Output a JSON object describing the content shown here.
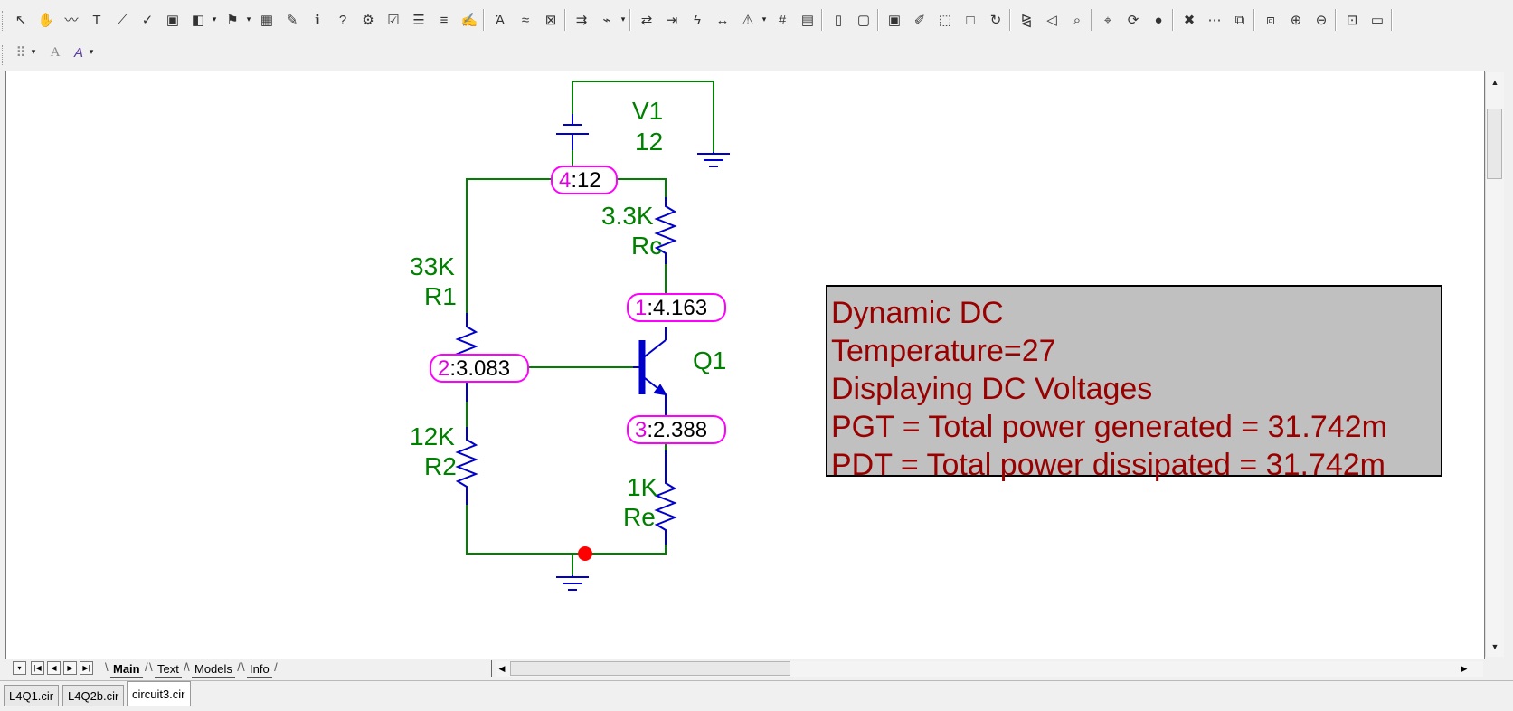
{
  "toolbar_main": {
    "buttons": [
      {
        "name": "select-mode-icon",
        "glyph": "↖"
      },
      {
        "name": "pan-mode-icon",
        "glyph": "✋"
      },
      {
        "name": "wire-mode-icon",
        "glyph": "〰"
      },
      {
        "name": "text-mode-icon",
        "glyph": "T"
      },
      {
        "name": "wire-draw-icon",
        "glyph": "⟋"
      },
      {
        "name": "diagonal-wire-icon",
        "glyph": "✓"
      },
      {
        "name": "component-icon",
        "glyph": "▣"
      },
      {
        "name": "shapes-icon",
        "glyph": "◧"
      },
      {
        "name": "flag-icon",
        "glyph": "⚑"
      },
      {
        "name": "grid-table-icon",
        "glyph": "▦"
      },
      {
        "name": "tool-icon",
        "glyph": "✎"
      },
      {
        "name": "info-icon",
        "glyph": "ℹ"
      },
      {
        "name": "help-icon",
        "glyph": "?"
      },
      {
        "name": "animate-icon",
        "glyph": "⚙"
      },
      {
        "name": "checkbox-icon",
        "glyph": "☑"
      },
      {
        "name": "properties-icon",
        "glyph": "☰"
      },
      {
        "name": "list-icon",
        "glyph": "≡"
      },
      {
        "name": "edit-icon",
        "glyph": "✍"
      },
      {
        "name": "attribute-text-icon",
        "glyph": "Ά"
      },
      {
        "name": "node-numbers-icon",
        "glyph": "≈"
      },
      {
        "name": "node-voltages-icon",
        "glyph": "⊠"
      },
      {
        "name": "currents-icon",
        "glyph": "⇉"
      },
      {
        "name": "power-icon",
        "glyph": "⌁"
      },
      {
        "name": "conditions-icon",
        "glyph": "⇄"
      },
      {
        "name": "pin-connections-icon",
        "glyph": "⇥"
      },
      {
        "name": "lightning-icon",
        "glyph": "ϟ"
      },
      {
        "name": "cross-arrows-icon",
        "glyph": "↔"
      },
      {
        "name": "warning-icon",
        "glyph": "⚠"
      },
      {
        "name": "grid-icon",
        "glyph": "#"
      },
      {
        "name": "page-icon",
        "glyph": "▤"
      },
      {
        "name": "blank-page-icon",
        "glyph": "▯"
      },
      {
        "name": "page-scale-icon",
        "glyph": "▢"
      },
      {
        "name": "subckt-icon",
        "glyph": "▣"
      },
      {
        "name": "edit-props-icon",
        "glyph": "✐"
      },
      {
        "name": "box-select-icon",
        "glyph": "⬚"
      },
      {
        "name": "empty-box-icon",
        "glyph": "□"
      },
      {
        "name": "rotate-icon",
        "glyph": "↻"
      },
      {
        "name": "mirror-icon",
        "glyph": "⧎"
      },
      {
        "name": "flip-icon",
        "glyph": "◁"
      },
      {
        "name": "find-icon",
        "glyph": "⌕"
      },
      {
        "name": "binoculars-icon",
        "glyph": "⌖"
      },
      {
        "name": "refresh-icon",
        "glyph": "⟳"
      },
      {
        "name": "circle-down-icon",
        "glyph": "●"
      },
      {
        "name": "circle-x-icon",
        "glyph": "✖"
      },
      {
        "name": "circle-more-icon",
        "glyph": "⋯"
      },
      {
        "name": "bring-front-icon",
        "glyph": "⧉"
      },
      {
        "name": "send-back-icon",
        "glyph": "⧈"
      },
      {
        "name": "zoom-in-icon",
        "glyph": "⊕"
      },
      {
        "name": "zoom-out-icon",
        "glyph": "⊖"
      },
      {
        "name": "zoom-fit-icon",
        "glyph": "⊡"
      },
      {
        "name": "camera-icon",
        "glyph": "▭"
      }
    ]
  },
  "toolbar_secondary": {
    "buttons": [
      {
        "name": "grid-dots-icon",
        "glyph": "⠿"
      },
      {
        "name": "font-icon",
        "glyph": "A"
      },
      {
        "name": "spellcheck-icon",
        "glyph": "A"
      }
    ]
  },
  "schematic": {
    "source": {
      "name": "V1",
      "value": "12"
    },
    "resistors": [
      {
        "name": "R1",
        "value": "33K"
      },
      {
        "name": "R2",
        "value": "12K"
      },
      {
        "name": "Rc",
        "value": "3.3K"
      },
      {
        "name": "Re",
        "value": "1K"
      }
    ],
    "transistor": {
      "name": "Q1"
    },
    "nodes": [
      {
        "num": "4",
        "volt": ":12"
      },
      {
        "num": "1",
        "volt": ":4.163"
      },
      {
        "num": "2",
        "volt": ":3.083"
      },
      {
        "num": "3",
        "volt": ":2.388"
      }
    ],
    "info_box": [
      "Dynamic DC",
      "Temperature=27",
      "Displaying DC Voltages",
      "PGT = Total power generated = 31.742m",
      "PDT = Total power dissipated = 31.742m"
    ]
  },
  "colors": {
    "wire": "#008000",
    "component": "#0000cc",
    "label": "#008000",
    "node_border": "#ff00ff",
    "node_number": "#e000e0",
    "info_text": "#990000",
    "info_bg": "#c0c0c0",
    "junction": "#ff0000"
  },
  "sheet_tabs": [
    "Main",
    "Text",
    "Models",
    "Info"
  ],
  "file_tabs": [
    "L4Q1.cir",
    "L4Q2b.cir",
    "circuit3.cir"
  ],
  "active_file_tab": "circuit3.cir"
}
